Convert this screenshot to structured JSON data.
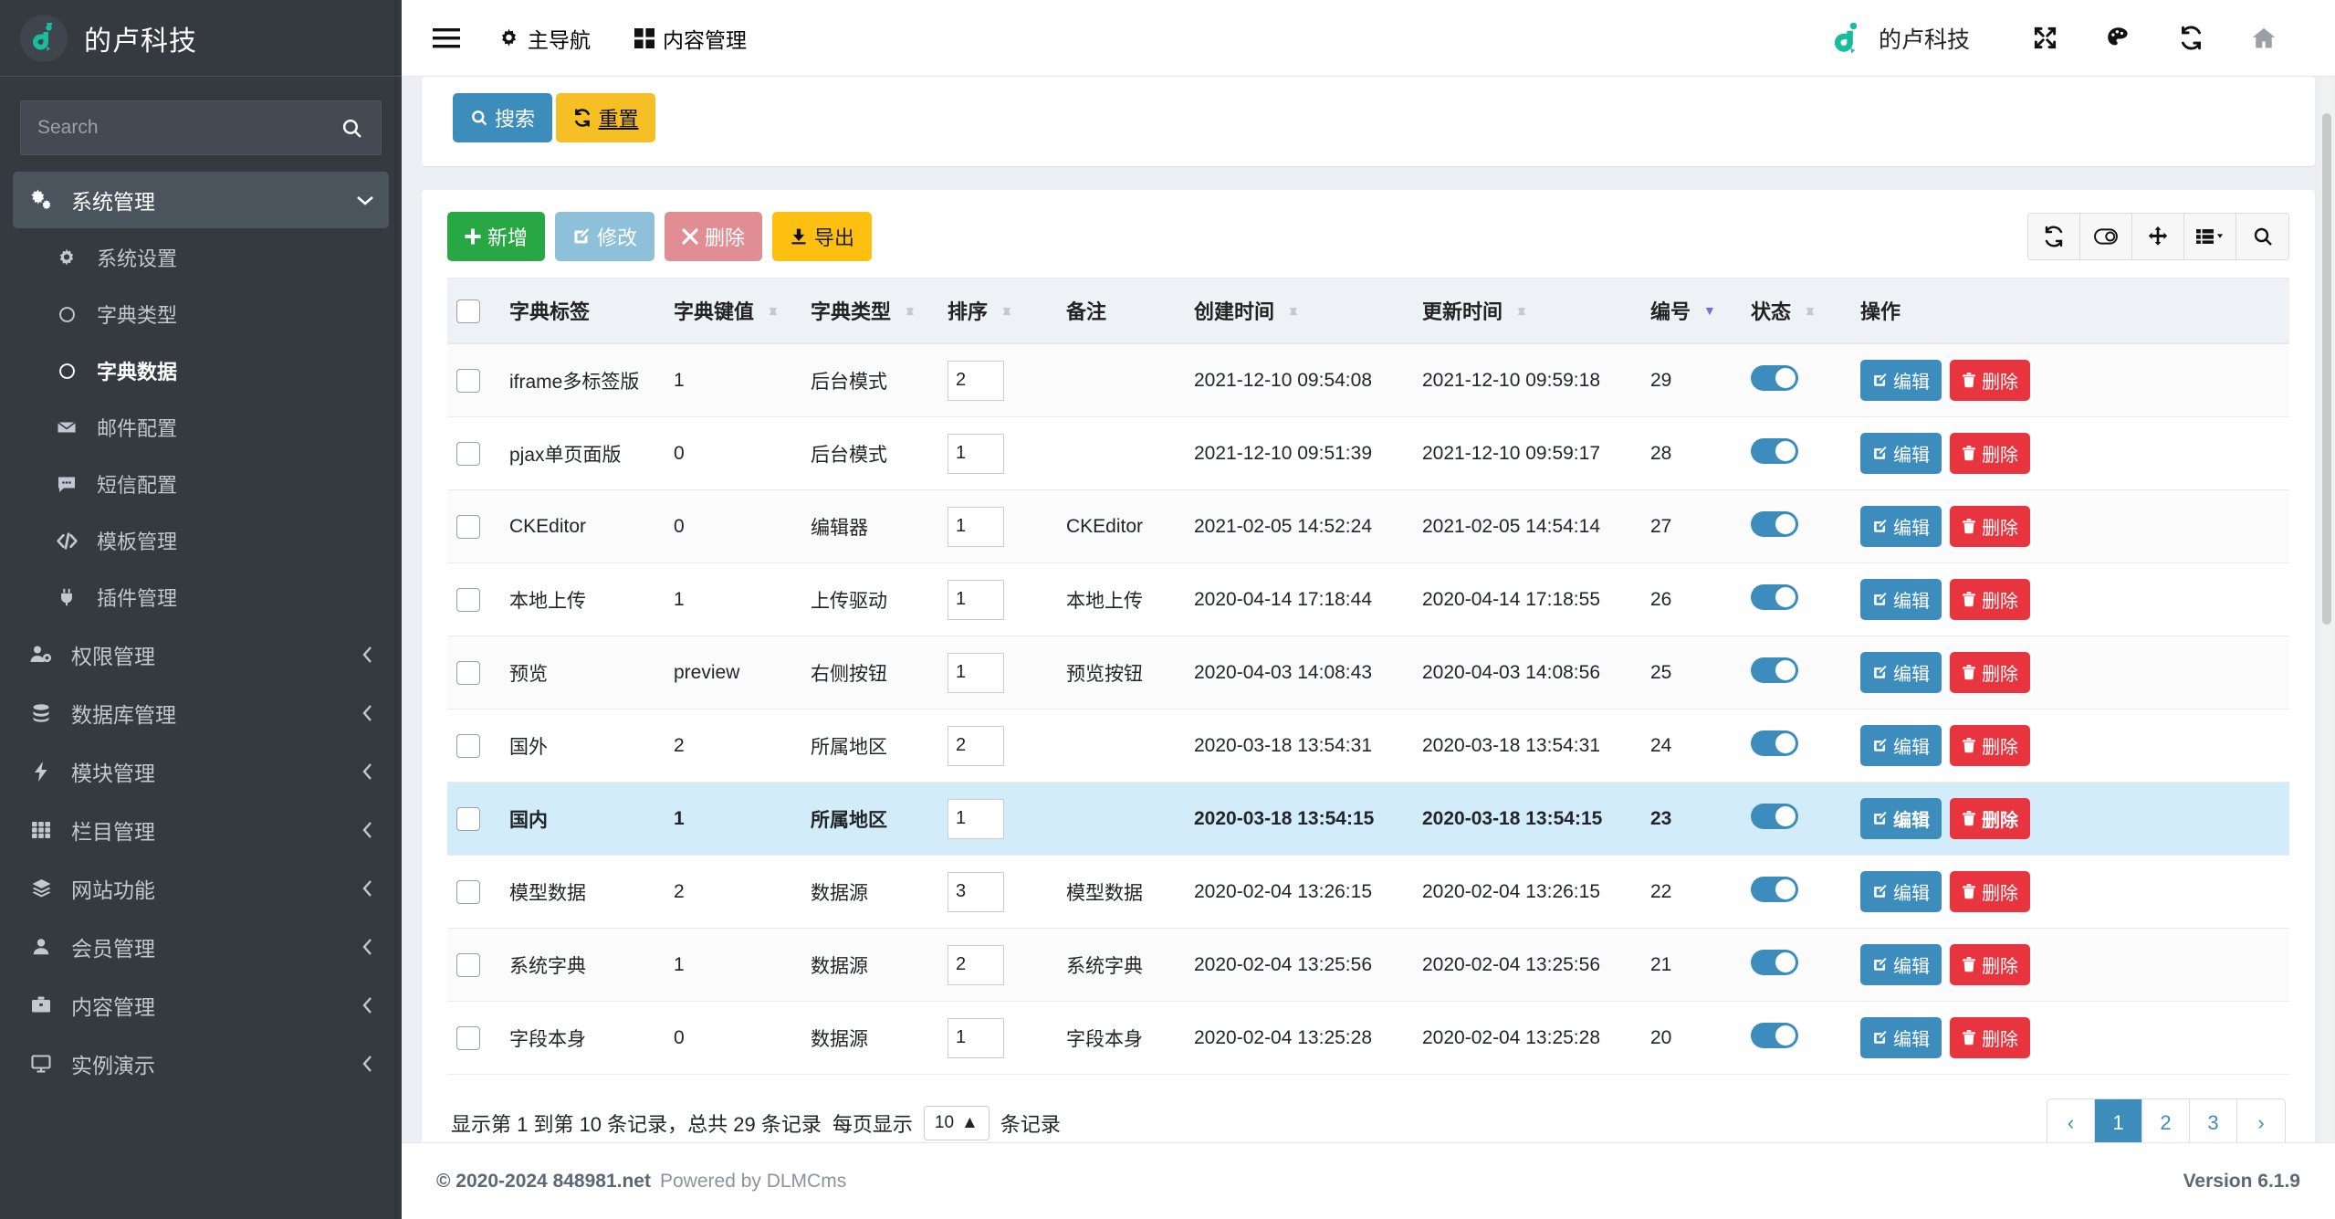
{
  "sidebar": {
    "brand": "的卢科技",
    "search_placeholder": "Search",
    "group": {
      "label": "系统管理",
      "icon": "gears-icon"
    },
    "sub_items": [
      {
        "label": "系统设置",
        "icon": "gear-icon"
      },
      {
        "label": "字典类型",
        "icon": "circle-icon"
      },
      {
        "label": "字典数据",
        "icon": "circle-icon"
      },
      {
        "label": "邮件配置",
        "icon": "envelope-icon"
      },
      {
        "label": "短信配置",
        "icon": "comment-icon"
      },
      {
        "label": "模板管理",
        "icon": "code-icon"
      },
      {
        "label": "插件管理",
        "icon": "plug-icon"
      }
    ],
    "items": [
      {
        "label": "权限管理",
        "icon": "user-gear-icon"
      },
      {
        "label": "数据库管理",
        "icon": "database-icon"
      },
      {
        "label": "模块管理",
        "icon": "bolt-icon"
      },
      {
        "label": "栏目管理",
        "icon": "grid-icon"
      },
      {
        "label": "网站功能",
        "icon": "layers-icon"
      },
      {
        "label": "会员管理",
        "icon": "user-icon"
      },
      {
        "label": "内容管理",
        "icon": "briefcase-icon"
      },
      {
        "label": "实例演示",
        "icon": "desktop-icon"
      }
    ]
  },
  "topbar": {
    "hamburger": "menu-icon",
    "links": [
      {
        "label": "主导航",
        "icon": "gear-icon"
      },
      {
        "label": "内容管理",
        "icon": "th-large-icon"
      }
    ],
    "brand": "的卢科技",
    "icons": [
      "fullscreen-icon",
      "palette-icon",
      "refresh-icon",
      "home-icon"
    ]
  },
  "search_panel": {
    "search_button": "搜索",
    "reset_button": "重置"
  },
  "toolbar": {
    "add": "新增",
    "edit": "修改",
    "delete": "删除",
    "export": "导出",
    "tools": [
      "refresh-icon",
      "toggle-icon",
      "fullscreen-arrows-icon",
      "columns-icon",
      "search-icon"
    ]
  },
  "table": {
    "columns": [
      {
        "label": "字典标签",
        "sort": "none"
      },
      {
        "label": "字典键值",
        "sort": "both"
      },
      {
        "label": "字典类型",
        "sort": "both"
      },
      {
        "label": "排序",
        "sort": "both"
      },
      {
        "label": "备注",
        "sort": "none"
      },
      {
        "label": "创建时间",
        "sort": "both"
      },
      {
        "label": "更新时间",
        "sort": "both"
      },
      {
        "label": "编号",
        "sort": "desc"
      },
      {
        "label": "状态",
        "sort": "both"
      },
      {
        "label": "操作",
        "sort": "none"
      }
    ],
    "row_actions": {
      "edit": "编辑",
      "delete": "删除"
    },
    "rows": [
      {
        "label": "iframe多标签版",
        "key": "1",
        "type": "后台模式",
        "order": "2",
        "remark": "",
        "created": "2021-12-10 09:54:08",
        "updated": "2021-12-10 09:59:18",
        "id": "29",
        "status": true,
        "selected": false
      },
      {
        "label": "pjax单页面版",
        "key": "0",
        "type": "后台模式",
        "order": "1",
        "remark": "",
        "created": "2021-12-10 09:51:39",
        "updated": "2021-12-10 09:59:17",
        "id": "28",
        "status": true,
        "selected": false
      },
      {
        "label": "CKEditor",
        "key": "0",
        "type": "编辑器",
        "order": "1",
        "remark": "CKEditor",
        "created": "2021-02-05 14:52:24",
        "updated": "2021-02-05 14:54:14",
        "id": "27",
        "status": true,
        "selected": false
      },
      {
        "label": "本地上传",
        "key": "1",
        "type": "上传驱动",
        "order": "1",
        "remark": "本地上传",
        "created": "2020-04-14 17:18:44",
        "updated": "2020-04-14 17:18:55",
        "id": "26",
        "status": true,
        "selected": false
      },
      {
        "label": "预览",
        "key": "preview",
        "type": "右侧按钮",
        "order": "1",
        "remark": "预览按钮",
        "created": "2020-04-03 14:08:43",
        "updated": "2020-04-03 14:08:56",
        "id": "25",
        "status": true,
        "selected": false
      },
      {
        "label": "国外",
        "key": "2",
        "type": "所属地区",
        "order": "2",
        "remark": "",
        "created": "2020-03-18 13:54:31",
        "updated": "2020-03-18 13:54:31",
        "id": "24",
        "status": true,
        "selected": false
      },
      {
        "label": "国内",
        "key": "1",
        "type": "所属地区",
        "order": "1",
        "remark": "",
        "created": "2020-03-18 13:54:15",
        "updated": "2020-03-18 13:54:15",
        "id": "23",
        "status": true,
        "selected": true
      },
      {
        "label": "模型数据",
        "key": "2",
        "type": "数据源",
        "order": "3",
        "remark": "模型数据",
        "created": "2020-02-04 13:26:15",
        "updated": "2020-02-04 13:26:15",
        "id": "22",
        "status": true,
        "selected": false
      },
      {
        "label": "系统字典",
        "key": "1",
        "type": "数据源",
        "order": "2",
        "remark": "系统字典",
        "created": "2020-02-04 13:25:56",
        "updated": "2020-02-04 13:25:56",
        "id": "21",
        "status": true,
        "selected": false
      },
      {
        "label": "字段本身",
        "key": "0",
        "type": "数据源",
        "order": "1",
        "remark": "字段本身",
        "created": "2020-02-04 13:25:28",
        "updated": "2020-02-04 13:25:28",
        "id": "20",
        "status": true,
        "selected": false
      }
    ]
  },
  "pagination": {
    "info_prefix": "显示第 1 到第 10 条记录，总共 29 条记录",
    "per_page_label": "每页显示",
    "per_page_value": "10",
    "per_page_suffix": "条记录",
    "prev": "‹",
    "next": "›",
    "pages": [
      "1",
      "2",
      "3"
    ],
    "current": "1"
  },
  "footer": {
    "copyright": "© 2020-2024 848981.net",
    "powered": "Powered by DLMCms",
    "version": "Version 6.1.9"
  },
  "colors": {
    "accent": "#3c8dbc",
    "green": "#27a844",
    "red": "#e7343f",
    "yellow": "#fdc010",
    "sidebar": "#343a40"
  }
}
